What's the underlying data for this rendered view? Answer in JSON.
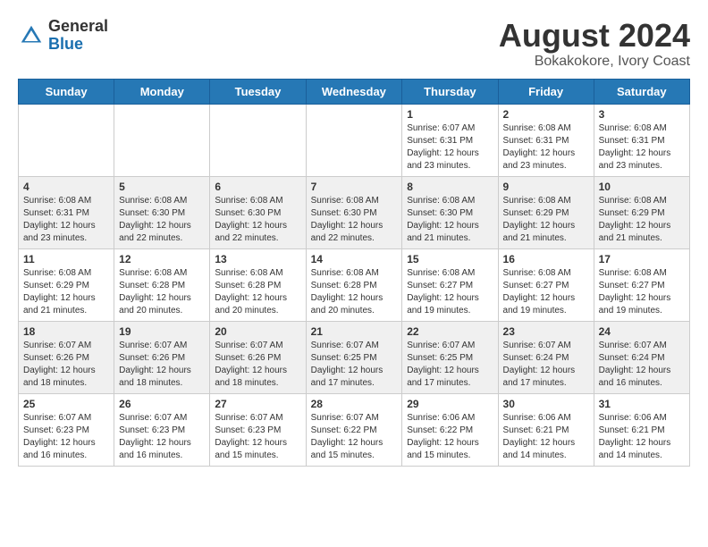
{
  "header": {
    "logo_general": "General",
    "logo_blue": "Blue",
    "month_year": "August 2024",
    "location": "Bokakokore, Ivory Coast"
  },
  "days_of_week": [
    "Sunday",
    "Monday",
    "Tuesday",
    "Wednesday",
    "Thursday",
    "Friday",
    "Saturday"
  ],
  "weeks": [
    [
      {
        "day": "",
        "info": ""
      },
      {
        "day": "",
        "info": ""
      },
      {
        "day": "",
        "info": ""
      },
      {
        "day": "",
        "info": ""
      },
      {
        "day": "1",
        "info": "Sunrise: 6:07 AM\nSunset: 6:31 PM\nDaylight: 12 hours\nand 23 minutes."
      },
      {
        "day": "2",
        "info": "Sunrise: 6:08 AM\nSunset: 6:31 PM\nDaylight: 12 hours\nand 23 minutes."
      },
      {
        "day": "3",
        "info": "Sunrise: 6:08 AM\nSunset: 6:31 PM\nDaylight: 12 hours\nand 23 minutes."
      }
    ],
    [
      {
        "day": "4",
        "info": "Sunrise: 6:08 AM\nSunset: 6:31 PM\nDaylight: 12 hours\nand 23 minutes."
      },
      {
        "day": "5",
        "info": "Sunrise: 6:08 AM\nSunset: 6:30 PM\nDaylight: 12 hours\nand 22 minutes."
      },
      {
        "day": "6",
        "info": "Sunrise: 6:08 AM\nSunset: 6:30 PM\nDaylight: 12 hours\nand 22 minutes."
      },
      {
        "day": "7",
        "info": "Sunrise: 6:08 AM\nSunset: 6:30 PM\nDaylight: 12 hours\nand 22 minutes."
      },
      {
        "day": "8",
        "info": "Sunrise: 6:08 AM\nSunset: 6:30 PM\nDaylight: 12 hours\nand 21 minutes."
      },
      {
        "day": "9",
        "info": "Sunrise: 6:08 AM\nSunset: 6:29 PM\nDaylight: 12 hours\nand 21 minutes."
      },
      {
        "day": "10",
        "info": "Sunrise: 6:08 AM\nSunset: 6:29 PM\nDaylight: 12 hours\nand 21 minutes."
      }
    ],
    [
      {
        "day": "11",
        "info": "Sunrise: 6:08 AM\nSunset: 6:29 PM\nDaylight: 12 hours\nand 21 minutes."
      },
      {
        "day": "12",
        "info": "Sunrise: 6:08 AM\nSunset: 6:28 PM\nDaylight: 12 hours\nand 20 minutes."
      },
      {
        "day": "13",
        "info": "Sunrise: 6:08 AM\nSunset: 6:28 PM\nDaylight: 12 hours\nand 20 minutes."
      },
      {
        "day": "14",
        "info": "Sunrise: 6:08 AM\nSunset: 6:28 PM\nDaylight: 12 hours\nand 20 minutes."
      },
      {
        "day": "15",
        "info": "Sunrise: 6:08 AM\nSunset: 6:27 PM\nDaylight: 12 hours\nand 19 minutes."
      },
      {
        "day": "16",
        "info": "Sunrise: 6:08 AM\nSunset: 6:27 PM\nDaylight: 12 hours\nand 19 minutes."
      },
      {
        "day": "17",
        "info": "Sunrise: 6:08 AM\nSunset: 6:27 PM\nDaylight: 12 hours\nand 19 minutes."
      }
    ],
    [
      {
        "day": "18",
        "info": "Sunrise: 6:07 AM\nSunset: 6:26 PM\nDaylight: 12 hours\nand 18 minutes."
      },
      {
        "day": "19",
        "info": "Sunrise: 6:07 AM\nSunset: 6:26 PM\nDaylight: 12 hours\nand 18 minutes."
      },
      {
        "day": "20",
        "info": "Sunrise: 6:07 AM\nSunset: 6:26 PM\nDaylight: 12 hours\nand 18 minutes."
      },
      {
        "day": "21",
        "info": "Sunrise: 6:07 AM\nSunset: 6:25 PM\nDaylight: 12 hours\nand 17 minutes."
      },
      {
        "day": "22",
        "info": "Sunrise: 6:07 AM\nSunset: 6:25 PM\nDaylight: 12 hours\nand 17 minutes."
      },
      {
        "day": "23",
        "info": "Sunrise: 6:07 AM\nSunset: 6:24 PM\nDaylight: 12 hours\nand 17 minutes."
      },
      {
        "day": "24",
        "info": "Sunrise: 6:07 AM\nSunset: 6:24 PM\nDaylight: 12 hours\nand 16 minutes."
      }
    ],
    [
      {
        "day": "25",
        "info": "Sunrise: 6:07 AM\nSunset: 6:23 PM\nDaylight: 12 hours\nand 16 minutes."
      },
      {
        "day": "26",
        "info": "Sunrise: 6:07 AM\nSunset: 6:23 PM\nDaylight: 12 hours\nand 16 minutes."
      },
      {
        "day": "27",
        "info": "Sunrise: 6:07 AM\nSunset: 6:23 PM\nDaylight: 12 hours\nand 15 minutes."
      },
      {
        "day": "28",
        "info": "Sunrise: 6:07 AM\nSunset: 6:22 PM\nDaylight: 12 hours\nand 15 minutes."
      },
      {
        "day": "29",
        "info": "Sunrise: 6:06 AM\nSunset: 6:22 PM\nDaylight: 12 hours\nand 15 minutes."
      },
      {
        "day": "30",
        "info": "Sunrise: 6:06 AM\nSunset: 6:21 PM\nDaylight: 12 hours\nand 14 minutes."
      },
      {
        "day": "31",
        "info": "Sunrise: 6:06 AM\nSunset: 6:21 PM\nDaylight: 12 hours\nand 14 minutes."
      }
    ]
  ]
}
